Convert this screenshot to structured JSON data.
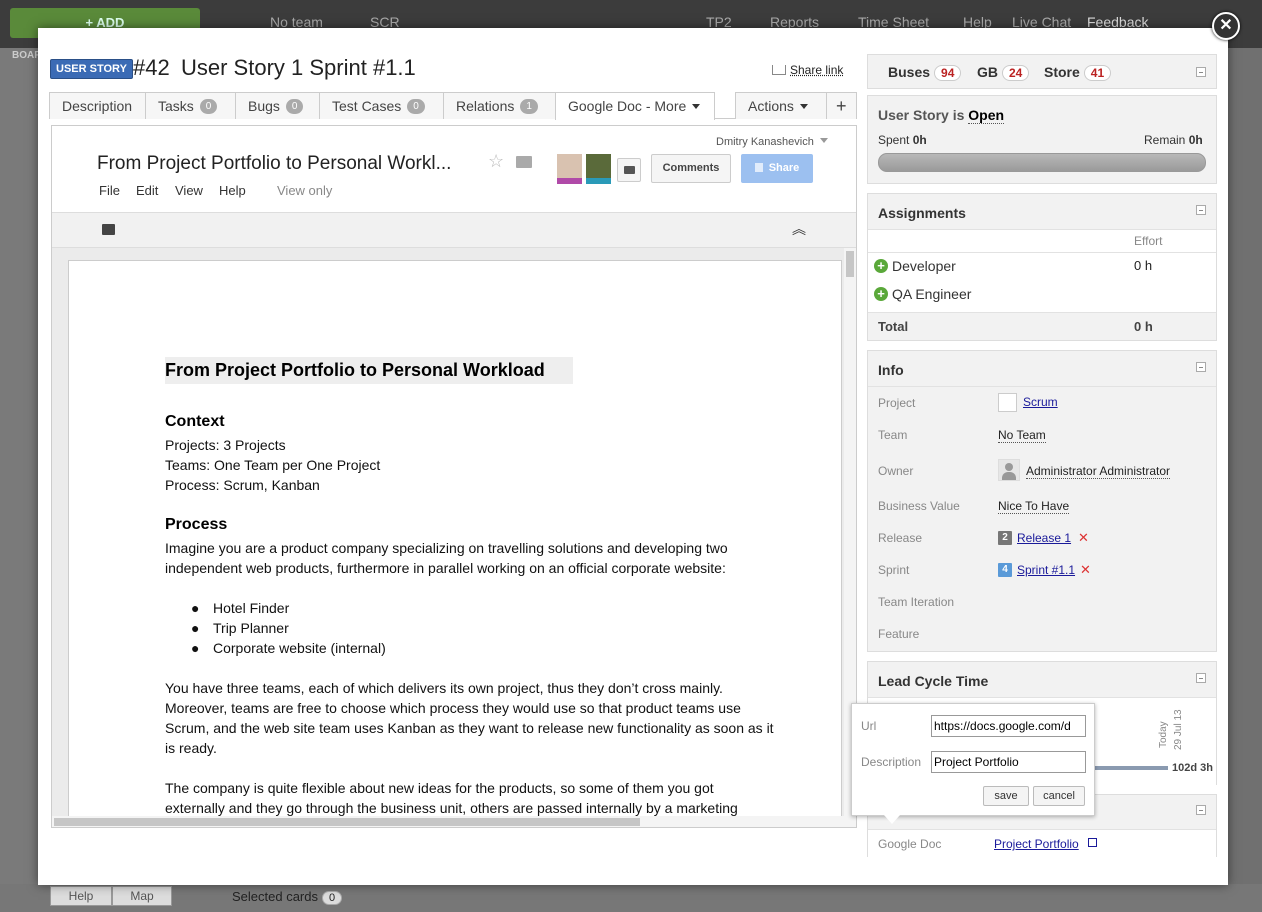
{
  "background": {
    "add_label": "+ ADD",
    "team_label": "No team",
    "scr_label": "SCR",
    "nav": [
      "TP2",
      "Reports",
      "Time Sheet",
      "Help",
      "Live Chat",
      "Feedback"
    ],
    "board_label": "BOAR",
    "help_btn": "Help",
    "map_btn": "Map",
    "selected_cards": "Selected cards",
    "selected_count": "0"
  },
  "entity": {
    "type_badge": "USER STORY",
    "id": "#42",
    "title": "User Story 1 Sprint #1.1",
    "share_link": "Share link"
  },
  "tabs": [
    {
      "label": "Description"
    },
    {
      "label": "Tasks",
      "count": "0"
    },
    {
      "label": "Bugs",
      "count": "0"
    },
    {
      "label": "Test Cases",
      "count": "0"
    },
    {
      "label": "Relations",
      "count": "1"
    },
    {
      "label": "Google Doc - More"
    },
    {
      "label": "Actions"
    },
    {
      "label": "+"
    }
  ],
  "gdoc": {
    "user": "Dmitry Kanashevich",
    "doc_title": "From Project Portfolio to Personal Workl...",
    "menu": [
      "File",
      "Edit",
      "View",
      "Help"
    ],
    "mode": "View only",
    "comments_btn": "Comments",
    "share_btn": "Share",
    "content": {
      "heading": "From Project Portfolio to Personal Workload",
      "context_title": "Context",
      "context_lines": [
        "Projects: 3 Projects",
        "Teams: One Team per One Project",
        "Process: Scrum, Kanban"
      ],
      "process_title": "Process",
      "process_para": "Imagine you are a product company specializing on travelling solutions and developing two independent web products, furthermore in parallel working on an official corporate website:",
      "bullets": [
        "Hotel Finder",
        "Trip Planner",
        "Corporate website (internal)"
      ],
      "para2": "You have three teams, each of which delivers its own project, thus they don’t cross mainly. Moreover, teams are free to choose which process they would use so that product teams use Scrum, and the web site team uses Kanban as they want to release new functionality as soon as it is ready.",
      "para3": "The company is quite flexible about new ideas for the products, so some of them you got externally and they go through the business unit, others are passed internally by a marketing"
    }
  },
  "counters": [
    {
      "label": "Buses",
      "count": "94"
    },
    {
      "label": "GB",
      "count": "24"
    },
    {
      "label": "Store",
      "count": "41"
    }
  ],
  "status": {
    "prefix": "User Story is",
    "state": "Open",
    "spent_label": "Spent",
    "spent_value": "0h",
    "remain_label": "Remain",
    "remain_value": "0h"
  },
  "assignments": {
    "title": "Assignments",
    "effort_header": "Effort",
    "rows": [
      {
        "role": "Developer",
        "effort": "0 h"
      },
      {
        "role": "QA Engineer",
        "effort": ""
      }
    ],
    "total_label": "Total",
    "total_value": "0 h"
  },
  "info": {
    "title": "Info",
    "project_label": "Project",
    "project_value": "Scrum",
    "team_label": "Team",
    "team_value": "No Team",
    "owner_label": "Owner",
    "owner_value": "Administrator Administrator",
    "bv_label": "Business Value",
    "bv_value": "Nice To Have",
    "release_label": "Release",
    "release_num": "2",
    "release_value": "Release 1",
    "sprint_label": "Sprint",
    "sprint_num": "4",
    "sprint_value": "Sprint #1.1",
    "iteration_label": "Team Iteration",
    "feature_label": "Feature"
  },
  "lead_cycle": {
    "title": "Lead Cycle Time",
    "today_label": "Today",
    "date_label": "29 Jul 13",
    "value": "102d 3h"
  },
  "google_doc_row": {
    "label": "Google Doc",
    "value": "Project Portfolio"
  },
  "popup": {
    "url_label": "Url",
    "url_value": "https://docs.google.com/d",
    "desc_label": "Description",
    "desc_value": "Project Portfolio",
    "save_btn": "save",
    "cancel_btn": "cancel"
  },
  "colors": {
    "badge_blue": "#3b6bb5",
    "count_red": "#b22222",
    "link_blue": "#1a1a9a",
    "plus_green": "#5aa83a"
  }
}
